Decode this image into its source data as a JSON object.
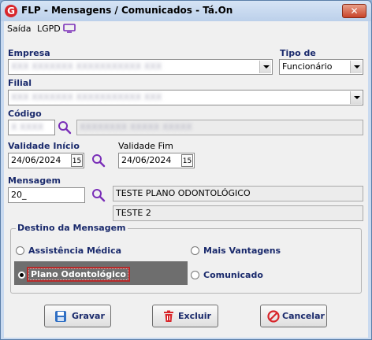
{
  "window": {
    "app_icon": "G",
    "title": "FLP - Mensagens / Comunicados - Tá.On",
    "close_glyph": "✕"
  },
  "menu": {
    "items": [
      "Saída",
      "LGPD"
    ],
    "tv_icon": "tv-icon"
  },
  "form": {
    "empresa_label": "Empresa",
    "empresa_value": "XXX XXXXXXX XXXXXXXXXXX XXX",
    "tipo_label": "Tipo de Mensagem",
    "tipo_value": "Funcionário",
    "filial_label": "Filial",
    "filial_value": "XXX XXXXXXX XXXXXXXXXXX XXX",
    "codigo_label": "Código",
    "codigo_value": "X XXXX",
    "codigo_desc": "XXXXXXXX XXXXX XXXXX",
    "validade_inicio_label": "Validade Início",
    "validade_inicio_value": "24/06/2024",
    "validade_fim_label": "Validade Fim",
    "validade_fim_value": "24/06/2024",
    "calendar_glyph": "15",
    "mensagem_label": "Mensagem",
    "mensagem_value": "20_",
    "mensagem_desc1": "TESTE PLANO ODONTOLÓGICO",
    "mensagem_desc2": "TESTE 2"
  },
  "destino": {
    "title": "Destino da Mensagem",
    "options": [
      "Assistência Médica",
      "Mais Vantagens",
      "Plano Odontológico",
      "Comunicado"
    ],
    "selected": "Plano Odontológico"
  },
  "buttons": {
    "gravar": "Gravar",
    "excluir": "Excluir",
    "cancelar": "Cancelar"
  },
  "colors": {
    "accent_purple": "#7a2fb8",
    "label_blue": "#1a2a6c",
    "delete_red": "#d8262b"
  }
}
